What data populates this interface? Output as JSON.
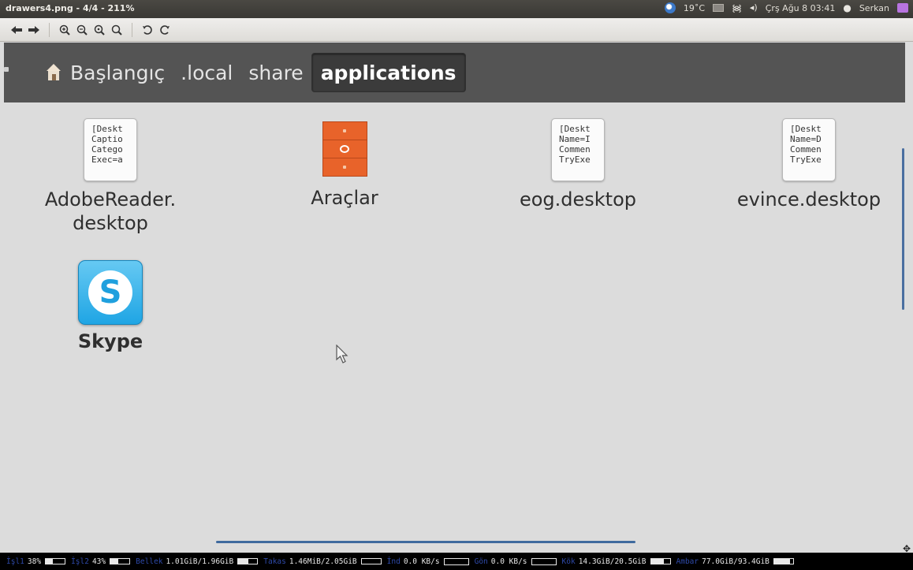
{
  "window": {
    "title": "drawers4.png - 4/4 - 211%"
  },
  "tray": {
    "temperature": "19˚C",
    "clock": "Çrş Ağu 8 03:41",
    "user": "Serkan"
  },
  "toolbar": {
    "buttons": [
      {
        "name": "back-button",
        "icon": "arrow-left-icon",
        "glyph": "◆"
      },
      {
        "name": "forward-button",
        "icon": "arrow-right-icon",
        "glyph": "◆"
      }
    ]
  },
  "breadcrumb": {
    "items": [
      "Başlangıç",
      ".local",
      "share",
      "applications"
    ],
    "active_index": 3
  },
  "files": [
    {
      "label_line1": "AdobeReader.",
      "label_line2": "desktop",
      "icon": "text-document-icon",
      "preview": [
        "[Deskt",
        "Captio",
        "Catego",
        "Exec=a"
      ]
    },
    {
      "label_line1": "Araçlar",
      "label_line2": "",
      "icon": "drawers-folder-icon"
    },
    {
      "label_line1": "eog.desktop",
      "label_line2": "",
      "icon": "text-document-icon",
      "preview": [
        "[Deskt",
        "Name=I",
        "Commen",
        "TryExe"
      ]
    },
    {
      "label_line1": "evince.desktop",
      "label_line2": "",
      "icon": "text-document-icon",
      "preview": [
        "[Deskt",
        "Name=D",
        "Commen",
        "TryExe"
      ]
    },
    {
      "label_line1": "Skype",
      "label_line2": "",
      "icon": "skype-icon",
      "glyph": "S"
    }
  ],
  "statusbar": {
    "cpu1_label": "İşl1",
    "cpu1_val": "38%",
    "cpu1_level": 0.38,
    "cpu2_label": "İşl2",
    "cpu2_val": "43%",
    "cpu2_level": 0.43,
    "mem_label": "Bellek",
    "mem_val": "1.01GiB/1.96GiB",
    "mem_level": 0.52,
    "swap_label": "Takas",
    "swap_val": "1.46MiB/2.05GiB",
    "swap_level": 0.0,
    "down_label": "İnd",
    "down_val": "0.0 KB/s",
    "up_label": "Gön",
    "up_val": "0.0 KB/s",
    "root_label": "Kök",
    "root_val": "14.3GiB/20.5GiB",
    "root_level": 0.7,
    "store_label": "Ambar",
    "store_val": "77.0GiB/93.4GiB",
    "store_level": 0.82
  }
}
